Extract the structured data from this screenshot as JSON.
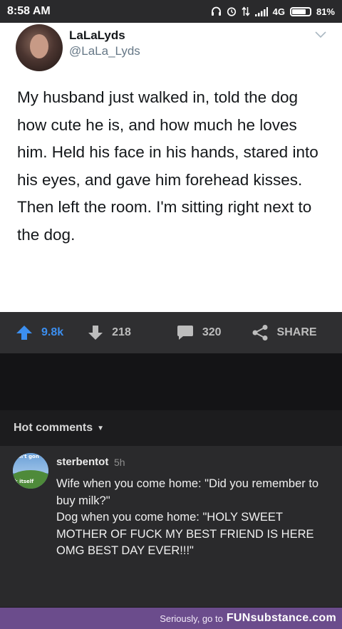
{
  "status_bar": {
    "time": "8:58 AM",
    "network": "4G",
    "battery": "81%",
    "battery_level": 0.81,
    "icons": [
      "headphones-icon",
      "alarm-icon",
      "data-arrows-icon",
      "signal-icon",
      "battery-icon"
    ]
  },
  "tweet": {
    "display_name": "LaLaLyds",
    "handle": "@LaLa_Lyds",
    "text": "My husband just walked in, told the dog how cute he is, and how much he loves him. Held his face in his hands, stared into his eyes, and gave him forehead kisses. Then left the room. I'm sitting right next to the dog."
  },
  "actions": {
    "upvotes": "9.8k",
    "downvotes": "218",
    "comments": "320",
    "share_label": "SHARE"
  },
  "hot_comments": {
    "header": "Hot comments",
    "comments": [
      {
        "avatar_text_top": "ain't gon",
        "avatar_text_bottom": "k itself",
        "username": "sterbentot",
        "time": "5h",
        "lines": [
          "Wife when you come home: \"Did you remember to buy milk?\"",
          "Dog when you come home: \"HOLY SWEET MOTHER OF FUCK MY BEST FRIEND IS HERE OMG BEST DAY EVER!!!\""
        ]
      }
    ]
  },
  "watermark": {
    "text": "Seriously, go to",
    "logo": "FUNsubstance.com"
  },
  "colors": {
    "accent_upvote": "#3c8ff0",
    "watermark_purple": "#6b4c8c",
    "background_dark": "#1c1c1e"
  }
}
